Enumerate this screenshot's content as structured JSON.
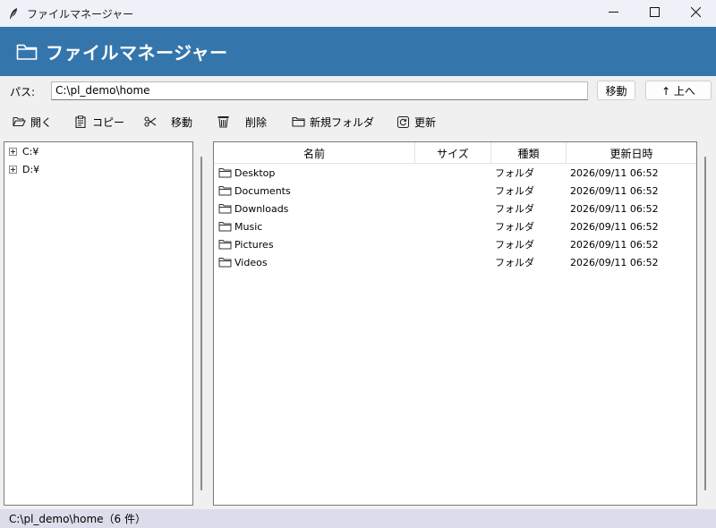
{
  "window": {
    "title": "ファイルマネージャー",
    "icon": "feather-icon",
    "controls": [
      "minimize-icon",
      "maximize-icon",
      "close-icon"
    ]
  },
  "header": {
    "title": "ファイルマネージャー",
    "icon": "folder-icon",
    "background": "#3476ac"
  },
  "pathbar": {
    "label": "パス:",
    "value": "C:\\pl_demo\\home",
    "move_label": "移動",
    "up_label": "↑ 上へ"
  },
  "toolbar": {
    "open_label": "開く",
    "copy_label": "コピー",
    "move_label": "移動",
    "delete_label": "削除",
    "new_folder_label": "新規フォルダ",
    "refresh_label": "更新"
  },
  "tree": {
    "items": [
      {
        "label": "C:¥"
      },
      {
        "label": "D:¥"
      }
    ]
  },
  "list": {
    "columns": [
      "名前",
      "サイズ",
      "種類",
      "更新日時"
    ],
    "rows": [
      {
        "name": "Desktop",
        "size": "",
        "kind": "フォルダ",
        "modified": "2026/09/11 06:52"
      },
      {
        "name": "Documents",
        "size": "",
        "kind": "フォルダ",
        "modified": "2026/09/11 06:52"
      },
      {
        "name": "Downloads",
        "size": "",
        "kind": "フォルダ",
        "modified": "2026/09/11 06:52"
      },
      {
        "name": "Music",
        "size": "",
        "kind": "フォルダ",
        "modified": "2026/09/11 06:52"
      },
      {
        "name": "Pictures",
        "size": "",
        "kind": "フォルダ",
        "modified": "2026/09/11 06:52"
      },
      {
        "name": "Videos",
        "size": "",
        "kind": "フォルダ",
        "modified": "2026/09/11 06:52"
      }
    ]
  },
  "status": {
    "text": "C:\\pl_demo\\home（6 件）"
  }
}
